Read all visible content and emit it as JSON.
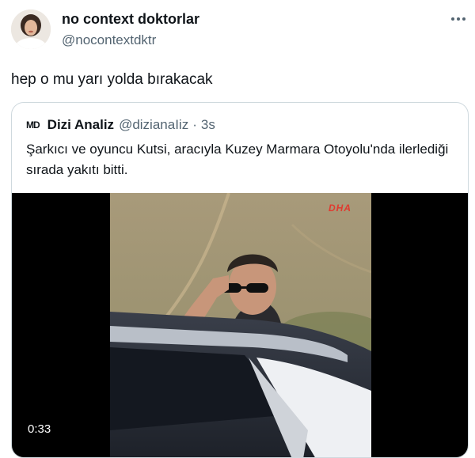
{
  "tweet": {
    "display_name": "no context doktorlar",
    "handle": "@nocontextdktr",
    "text": "hep o mu yarı yolda bırakacak",
    "avatar_icon": "user-avatar-photo",
    "more_icon": "more-horizontal-icon"
  },
  "quoted_tweet": {
    "logo_text": "MD",
    "display_name": "Dizi Analiz",
    "handle": "@dizianaIiz",
    "separator": "·",
    "time": "3s",
    "text": "Şarkıcı ve oyuncu Kutsi, aracıyla Kuzey Marmara Otoyolu'nda ilerlediği sırada yakıtı bitti."
  },
  "video": {
    "watermark": "DHA",
    "duration": "0:33"
  }
}
